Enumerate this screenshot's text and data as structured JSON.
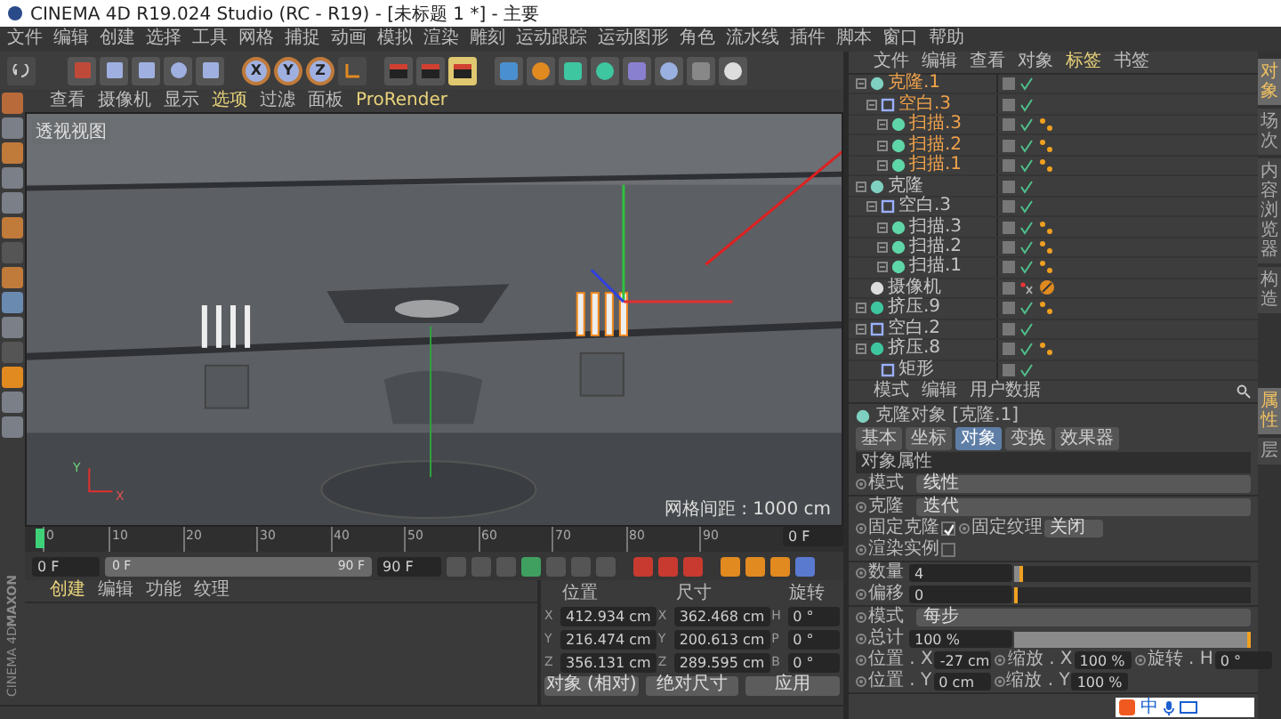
{
  "window": {
    "title": "CINEMA 4D R19.024 Studio (RC - R19) - [未标题 1 *] - 主要"
  },
  "menu": [
    "文件",
    "编辑",
    "创建",
    "选择",
    "工具",
    "网格",
    "捕捉",
    "动画",
    "模拟",
    "渲染",
    "雕刻",
    "运动跟踪",
    "运动图形",
    "角色",
    "流水线",
    "插件",
    "脚本",
    "窗口",
    "帮助"
  ],
  "toolbar": {
    "axes": [
      "X",
      "Y",
      "Z"
    ]
  },
  "viewport": {
    "menu": [
      {
        "label": "查看",
        "active": false
      },
      {
        "label": "摄像机",
        "active": false
      },
      {
        "label": "显示",
        "active": false
      },
      {
        "label": "选项",
        "active": true
      },
      {
        "label": "过滤",
        "active": false
      },
      {
        "label": "面板",
        "active": false
      },
      {
        "label": "ProRender",
        "active": true
      }
    ],
    "view_name": "透视视图",
    "axis_labels": [
      "Y",
      "X"
    ],
    "grid_spacing": "网格间距 : 1000 cm"
  },
  "timeline": {
    "ticks": [
      "0",
      "10",
      "20",
      "30",
      "40",
      "50",
      "60",
      "70",
      "80",
      "90"
    ],
    "current_frame": "0 F"
  },
  "playback": {
    "start": "0 F",
    "range": {
      "start": "0 F",
      "end": "90 F",
      "level": 1
    },
    "end": "90 F"
  },
  "material_manager": {
    "menu": [
      {
        "label": "创建",
        "active": true
      },
      {
        "label": "编辑",
        "active": false
      },
      {
        "label": "功能",
        "active": false
      },
      {
        "label": "纹理",
        "active": false
      }
    ]
  },
  "coordinates": {
    "headers": [
      "位置",
      "尺寸",
      "旋转"
    ],
    "rows": [
      {
        "axis": "X",
        "position": "412.934 cm",
        "size_axis": "X",
        "size": "362.468 cm",
        "rotation_axis": "H",
        "rotation": "0 °"
      },
      {
        "axis": "Y",
        "position": "216.474 cm",
        "size_axis": "Y",
        "size": "200.613 cm",
        "rotation_axis": "P",
        "rotation": "0 °"
      },
      {
        "axis": "Z",
        "position": "356.131 cm",
        "size_axis": "Z",
        "size": "289.595 cm",
        "rotation_axis": "B",
        "rotation": "0 °"
      }
    ],
    "mode": "对象 (相对)",
    "size_mode": "绝对尺寸",
    "apply": "应用"
  },
  "side_logo": {
    "brand": "MAXON",
    "product": "CINEMA 4D"
  },
  "object_manager": {
    "menu": [
      {
        "label": "文件",
        "active": false
      },
      {
        "label": "编辑",
        "active": false
      },
      {
        "label": "查看",
        "active": false
      },
      {
        "label": "对象",
        "active": false
      },
      {
        "label": "标签",
        "active": true
      },
      {
        "label": "书签",
        "active": false
      }
    ],
    "objects": [
      {
        "name": "克隆.1",
        "kind": "cloner",
        "selected": true,
        "children": [
          {
            "name": "空白.3",
            "kind": "null",
            "selected": true,
            "children": [
              {
                "name": "扫描.3",
                "kind": "sweep",
                "selected": true
              },
              {
                "name": "扫描.2",
                "kind": "sweep",
                "selected": true
              },
              {
                "name": "扫描.1",
                "kind": "sweep",
                "selected": true
              }
            ]
          }
        ]
      },
      {
        "name": "克隆",
        "kind": "cloner",
        "selected": false,
        "children": [
          {
            "name": "空白.3",
            "kind": "null",
            "selected": false,
            "children": [
              {
                "name": "扫描.3",
                "kind": "sweep",
                "selected": false
              },
              {
                "name": "扫描.2",
                "kind": "sweep",
                "selected": false
              },
              {
                "name": "扫描.1",
                "kind": "sweep",
                "selected": false
              }
            ]
          }
        ]
      },
      {
        "name": "摄像机",
        "kind": "camera",
        "selected": false
      },
      {
        "name": "挤压.9",
        "kind": "extrude",
        "selected": false
      },
      {
        "name": "空白.2",
        "kind": "null",
        "selected": false
      },
      {
        "name": "挤压.8",
        "kind": "extrude",
        "selected": false,
        "children": [
          {
            "name": "矩形",
            "kind": "rectangle",
            "selected": false
          }
        ]
      }
    ]
  },
  "attributes": {
    "menu": [
      "模式",
      "编辑",
      "用户数据"
    ],
    "object_title": "克隆对象 [克隆.1]",
    "tabs": [
      {
        "label": "基本",
        "selected": false
      },
      {
        "label": "坐标",
        "selected": false
      },
      {
        "label": "对象",
        "selected": true
      },
      {
        "label": "变换",
        "selected": false
      },
      {
        "label": "效果器",
        "selected": false
      }
    ],
    "section": "对象属性",
    "groups": [
      {
        "rows": [
          {
            "items": [
              {
                "kind": "dropdown",
                "label": "模式",
                "value": "线性"
              }
            ]
          }
        ]
      },
      {
        "rows": [
          {
            "items": [
              {
                "kind": "dropdown",
                "label": "克隆",
                "value": "迭代"
              }
            ]
          },
          {
            "items": [
              {
                "kind": "checkbox",
                "label": "固定克隆",
                "checked": true
              },
              {
                "kind": "small_dropdown",
                "label": "固定纹理",
                "value": "关闭"
              }
            ]
          },
          {
            "items": [
              {
                "kind": "checkbox",
                "label": "渲染实例",
                "checked": false
              }
            ]
          }
        ]
      },
      {
        "rows": [
          {
            "items": [
              {
                "kind": "slider",
                "label": "数量",
                "value": "4",
                "level": 0.04
              }
            ]
          },
          {
            "items": [
              {
                "kind": "slider",
                "label": "偏移",
                "value": "0",
                "level": 0
              }
            ]
          }
        ]
      },
      {
        "rows": [
          {
            "items": [
              {
                "kind": "dropdown",
                "label": "模式",
                "value": "每步"
              }
            ]
          },
          {
            "items": [
              {
                "kind": "slider",
                "label": "总计",
                "value": "100 %",
                "level": 1
              }
            ]
          },
          {
            "items": [
              {
                "kind": "number",
                "label": "位置 . X",
                "value": "-27 cm"
              },
              {
                "kind": "number",
                "label": "缩放 . X",
                "value": "100 %"
              },
              {
                "kind": "number",
                "label": "旋转 . H",
                "value": "0 °"
              }
            ]
          },
          {
            "items": [
              {
                "kind": "number",
                "label": "位置 . Y",
                "value": "0 cm"
              },
              {
                "kind": "number",
                "label": "缩放 . Y",
                "value": "100 %"
              }
            ]
          }
        ]
      }
    ]
  },
  "right_tabs": {
    "upper": [
      {
        "label": "对象",
        "selected": true
      },
      {
        "label": "场次",
        "selected": false
      },
      {
        "label": "内容浏览器",
        "selected": false
      },
      {
        "label": "构造",
        "selected": false
      }
    ],
    "lower": [
      {
        "label": "属性",
        "selected": true
      },
      {
        "label": "层",
        "selected": false
      }
    ]
  },
  "ime_bar": {
    "mode": "中"
  }
}
